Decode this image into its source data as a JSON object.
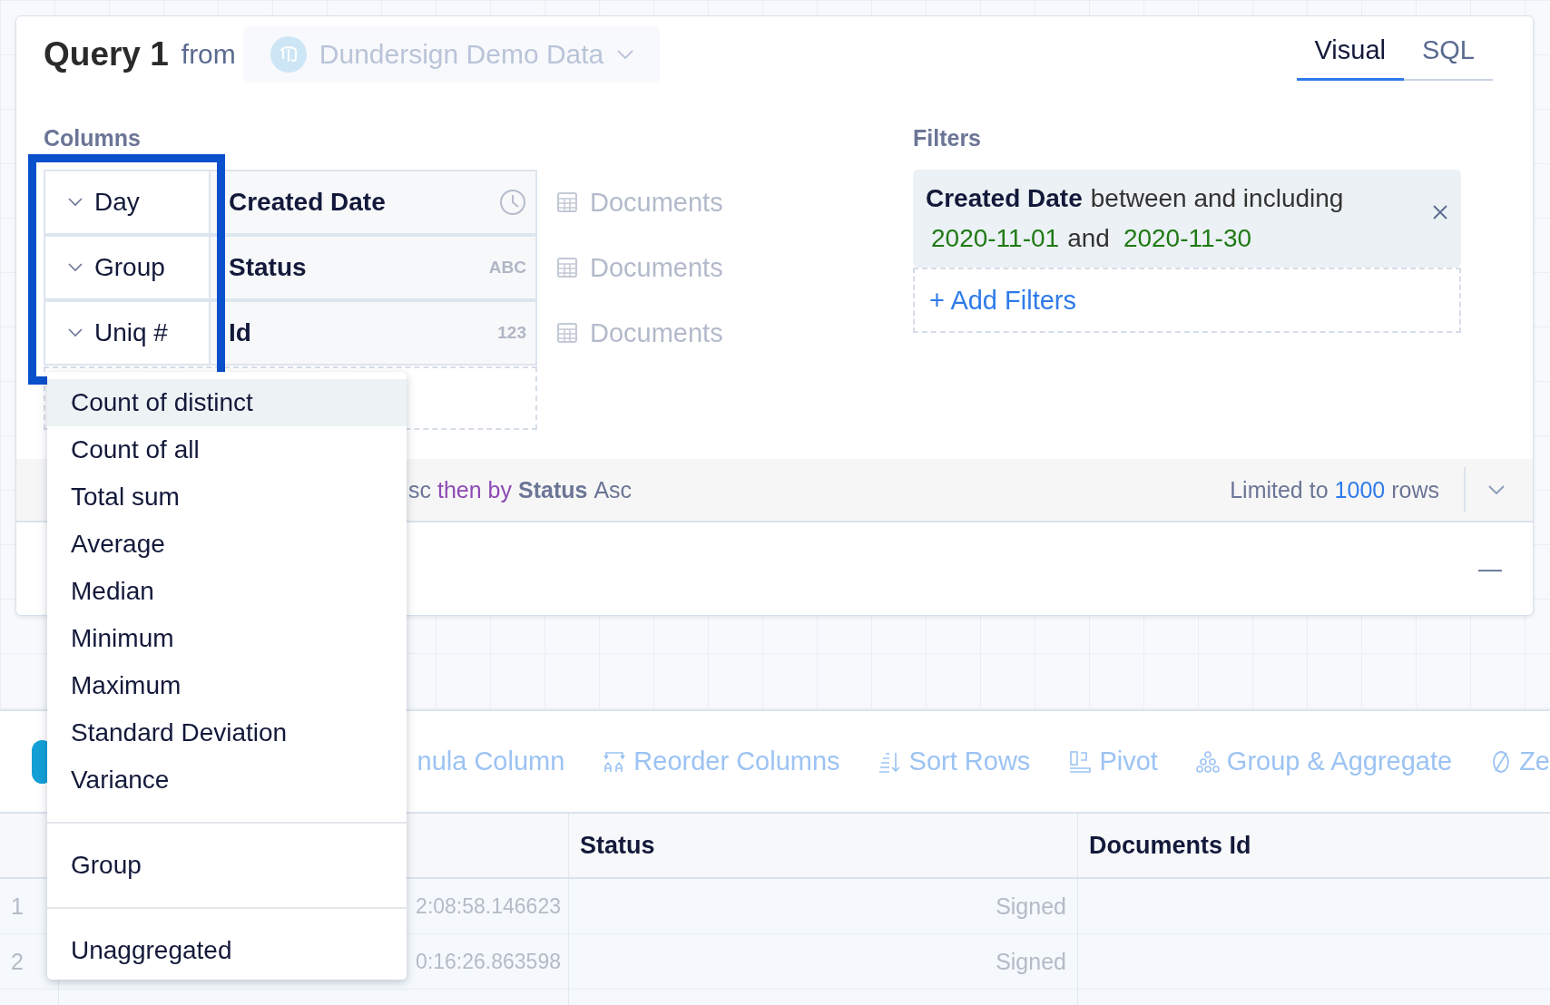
{
  "query": {
    "title": "Query 1",
    "from_label": "from",
    "source": {
      "name": "Dundersign Demo Data",
      "disabled": true
    },
    "tabs": [
      {
        "label": "Visual",
        "selected": true
      },
      {
        "label": "SQL",
        "selected": false
      }
    ]
  },
  "columns": {
    "heading": "Columns",
    "rows": [
      {
        "aggregate": "Day",
        "field": "Created Date",
        "kind": "date",
        "table": "Documents"
      },
      {
        "aggregate": "Group",
        "field": "Status",
        "kind": "text",
        "type_label": "ABC",
        "table": "Documents"
      },
      {
        "aggregate": "Uniq #",
        "field": "Id",
        "kind": "number",
        "type_label": "123",
        "table": "Documents"
      }
    ]
  },
  "filters": {
    "heading": "Filters",
    "items": [
      {
        "lines": [
          [
            {
              "kind": "field",
              "text": "Created Date"
            },
            {
              "kind": "plain",
              "text": "between and including"
            }
          ],
          [
            {
              "kind": "value",
              "text": "2020-11-01"
            },
            {
              "kind": "plain",
              "text": "and"
            },
            {
              "kind": "value",
              "text": "2020-11-30"
            }
          ]
        ]
      }
    ],
    "add_label": "+ Add Filters"
  },
  "sort_bar": {
    "parts": [
      {
        "kind": "plain",
        "text": "sc"
      },
      {
        "kind": "keyword",
        "text": "then by"
      },
      {
        "kind": "field",
        "text": "Status"
      },
      {
        "kind": "plain",
        "text": "Asc"
      }
    ],
    "limit_parts": [
      {
        "kind": "plain",
        "text": "Limited to"
      },
      {
        "kind": "link",
        "text": "1000"
      },
      {
        "kind": "plain",
        "text": "rows"
      }
    ]
  },
  "collapse_label": "—",
  "toolbar": [
    {
      "kind": "plain",
      "label": "nula Column"
    },
    {
      "kind": "reorder",
      "label": "Reorder Columns"
    },
    {
      "kind": "sort",
      "label": "Sort Rows"
    },
    {
      "kind": "pivot",
      "label": "Pivot"
    },
    {
      "kind": "group",
      "label": "Group & Aggregate"
    },
    {
      "kind": "zero",
      "label": "Ze"
    }
  ],
  "table": {
    "columns": [
      "Status",
      "Documents Id"
    ],
    "rows": [
      {
        "number": "1",
        "column_1": "2:08:58.146623",
        "status": "Signed"
      },
      {
        "number": "2",
        "column_1": "0:16:26.863598",
        "status": "Signed"
      }
    ]
  },
  "menu": {
    "sections": [
      {
        "items": [
          {
            "label": "Count of distinct",
            "selected": true
          },
          {
            "label": "Count of all",
            "selected": false
          },
          {
            "label": "Total sum",
            "selected": false
          },
          {
            "label": "Average",
            "selected": false
          },
          {
            "label": "Median",
            "selected": false
          },
          {
            "label": "Minimum",
            "selected": false
          },
          {
            "label": "Maximum",
            "selected": false
          },
          {
            "label": "Standard Deviation",
            "selected": false
          },
          {
            "label": "Variance",
            "selected": false
          }
        ]
      },
      {
        "items": [
          {
            "label": "Group",
            "selected": false
          }
        ]
      },
      {
        "items": [
          {
            "label": "Unaggregated",
            "selected": false
          }
        ]
      }
    ]
  }
}
